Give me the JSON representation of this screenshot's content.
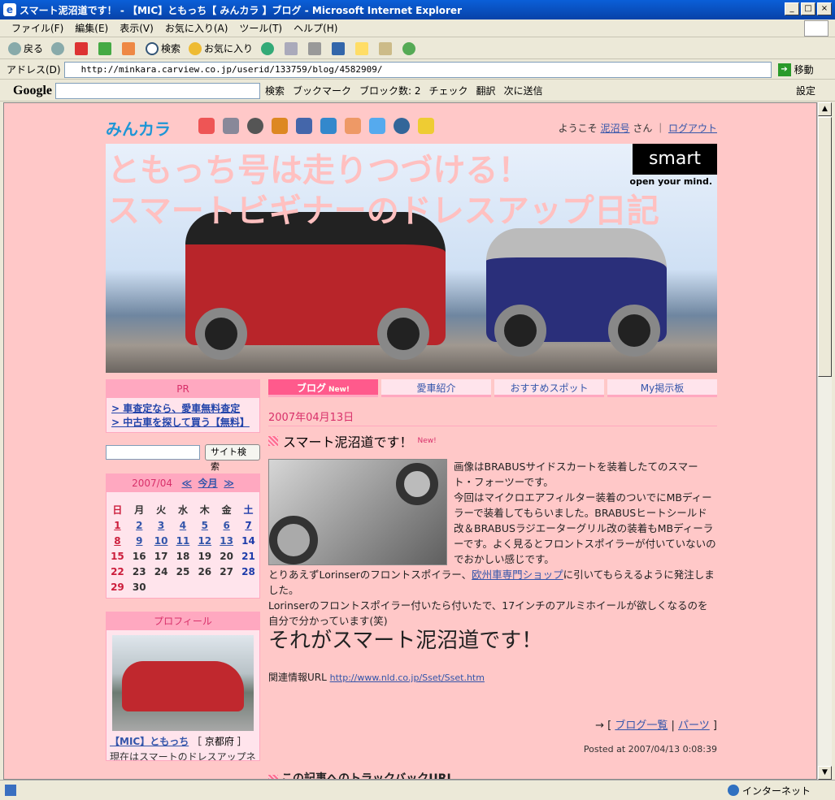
{
  "window": {
    "title": "スマート泥沼道です！ - 【MIC】ともっち【 みんカラ 】ブログ - Microsoft Internet Explorer",
    "controls": [
      "_",
      "□",
      "×"
    ]
  },
  "menu": [
    "ファイル(F)",
    "編集(E)",
    "表示(V)",
    "お気に入り(A)",
    "ツール(T)",
    "ヘルプ(H)"
  ],
  "toolbar": {
    "back": "戻る",
    "search": "検索",
    "favorites": "お気に入り"
  },
  "address": {
    "label": "アドレス(D)",
    "url": "http://minkara.carview.co.jp/userid/133759/blog/4582909/",
    "go": "移動"
  },
  "google": {
    "logo": "Google",
    "items": [
      "検索",
      "ブックマーク",
      "ブロック数: 2",
      "チェック",
      "翻訳",
      "次に送信"
    ],
    "settings": "設定"
  },
  "site": {
    "logo": "みんカラ",
    "welcome_prefix": "ようこそ",
    "user": "泥沼号",
    "welcome_suffix": "さん ｜",
    "logout": "ログアウト"
  },
  "banner": {
    "line1": "ともっち号は走りつづける！",
    "line2": "スマートビギナーのドレスアップ日記",
    "brand": "smart",
    "tagline": "open your mind."
  },
  "sidebar": {
    "pr_title": "PR",
    "pr_links": [
      "> 車査定なら、愛車無料査定",
      "> 中古車を探して買う【無料】"
    ],
    "search_button": "サイト検索",
    "calendar": {
      "month": "2007/04",
      "prev": "≪",
      "today": "今月",
      "next": "≫",
      "weekdays": [
        "日",
        "月",
        "火",
        "水",
        "木",
        "金",
        "土"
      ],
      "weeks": [
        [
          "1",
          "2",
          "3",
          "4",
          "5",
          "6",
          "7"
        ],
        [
          "8",
          "9",
          "10",
          "11",
          "12",
          "13",
          "14"
        ],
        [
          "15",
          "16",
          "17",
          "18",
          "19",
          "20",
          "21"
        ],
        [
          "22",
          "23",
          "24",
          "25",
          "26",
          "27",
          "28"
        ],
        [
          "29",
          "30",
          "",
          "",
          "",
          "",
          ""
        ]
      ],
      "linked_days": [
        "1",
        "2",
        "3",
        "4",
        "5",
        "6",
        "7",
        "8",
        "9",
        "10",
        "11",
        "12",
        "13"
      ]
    },
    "profile_title": "プロフィール",
    "profile_name": "【MIC】ともっち",
    "profile_pref": "［ 京都府 ］",
    "profile_bio": "現在はスマートのドレスアップネタ"
  },
  "tabs": [
    {
      "label": "ブログ",
      "badge": "New!",
      "active": true
    },
    {
      "label": "愛車紹介",
      "active": false
    },
    {
      "label": "おすすめスポット",
      "active": false
    },
    {
      "label": "My掲示板",
      "active": false
    }
  ],
  "post": {
    "date": "2007年04月13日",
    "title": "スマート泥沼道です！",
    "new_badge": "New!",
    "para1": "画像はBRABUSサイドスカートを装着したてのスマート・フォーツーです。",
    "para2": "今回はマイクロエアフィルター装着のついでにMBディーラーで装着してもらいました。BRABUSヒートシールド改＆BRABUSラジエーターグリル改の装着もMBディーラーです。よく見るとフロントスポイラーが付いていないのでおかしい感じです。",
    "para3_before": "とりあえずLorinserのフロントスポイラー、",
    "para3_link": "欧州車専門ショップ",
    "para3_after": "に引いてもらえるように発注しました。",
    "para4": "Lorinserのフロントスポイラー付いたら付いたで、17インチのアルミホイールが欲しくなるのを自分で分かっています(笑)",
    "big": "それがスマート泥沼道です！",
    "related_label": "関連情報URL",
    "related_url": "http://www.nld.co.jp/Sset/Sset.htm",
    "nav_prefix": "→ [",
    "nav_list": "ブログ一覧",
    "nav_sep": "|",
    "nav_parts": "パーツ",
    "nav_suffix": "]",
    "posted": "Posted at 2007/04/13 0:08:39",
    "trackback": "この記事へのトラックバックURL"
  },
  "status": {
    "zone": "インターネット"
  }
}
